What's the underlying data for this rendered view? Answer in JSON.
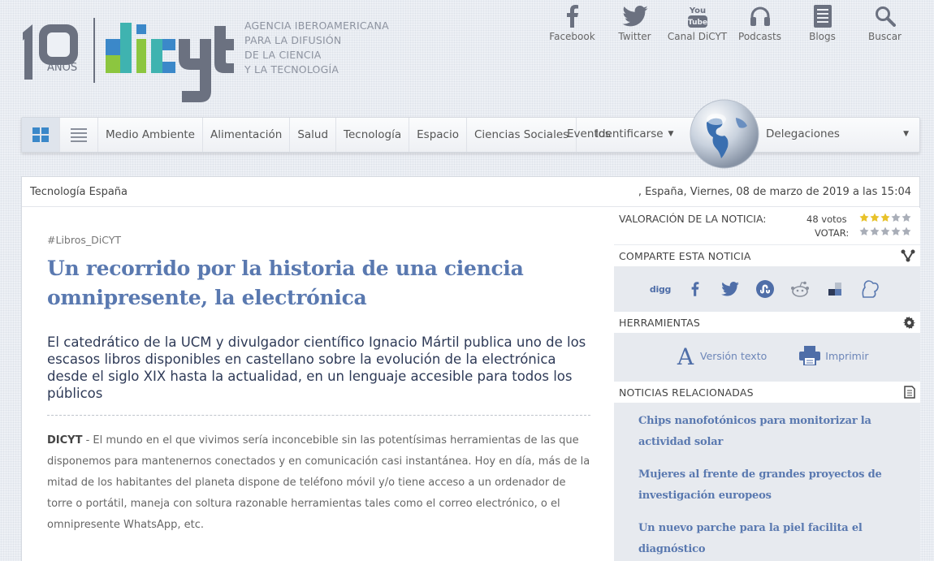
{
  "brand": {
    "anniversary_number": "10",
    "anniversary_label": "AÑOS",
    "name": "dicyt",
    "tagline_lines": [
      "AGENCIA IBEROAMERICANA",
      "PARA LA DIFUSIÓN",
      "DE LA CIENCIA",
      "Y LA TECNOLOGÍA"
    ],
    "colors": {
      "blue": "#3b88c9",
      "teal": "#3fb3b0",
      "green": "#8cc63f",
      "gray": "#6b7180"
    }
  },
  "social": [
    {
      "label": "Facebook",
      "icon": "facebook-icon"
    },
    {
      "label": "Twitter",
      "icon": "twitter-icon"
    },
    {
      "label": "Canal DiCYT",
      "icon": "youtube-icon"
    },
    {
      "label": "Podcasts",
      "icon": "headphones-icon"
    },
    {
      "label": "Blogs",
      "icon": "blog-icon"
    },
    {
      "label": "Buscar",
      "icon": "search-icon"
    }
  ],
  "nav": {
    "items": [
      "Medio Ambiente",
      "Alimentación",
      "Salud",
      "Tecnología",
      "Espacio",
      "Ciencias Sociales"
    ],
    "eventos": "Eventos",
    "login": "Identificarse",
    "delegaciones": "Delegaciones"
  },
  "crumb": {
    "section": "Tecnología España",
    "dateline": ", España, Viernes, 08 de marzo de 2019 a las 15:04"
  },
  "article": {
    "tag": "#Libros_DiCYT",
    "title": "Un recorrido por la historia de una ciencia omnipresente, la electrónica",
    "subtitle": "El catedrático de la UCM y divulgador científico Ignacio Mártil publica uno de los escasos libros disponibles en castellano sobre la evolución de la electrónica desde el siglo XIX hasta la actualidad, en un lenguaje accesible para todos los públicos",
    "lead_source": "DICYT",
    "lead_text": " - El mundo en el que vivimos sería inconcebible sin las potentísimas herramientas de las que disponemos para mantenernos conectados y en comunicación casi instantánea. Hoy en día, más de la mitad de los habitantes del planeta dispone de teléfono móvil y/o tiene acceso a un ordenador de torre o portátil, maneja con soltura razonable herramientas tales como el correo electrónico, o el omnipresente WhatsApp, etc."
  },
  "sidebar": {
    "rating_label": "VALORACIÓN DE LA NOTICIA:",
    "votes": "48 votos",
    "vote_label": "VOTAR:",
    "rating_stars": 3,
    "share_label": "COMPARTE ESTA NOTICIA",
    "share_icons": [
      "digg-icon",
      "facebook-icon",
      "twitter-icon",
      "stumbleupon-icon",
      "reddit-icon",
      "delicious-icon",
      "meneame-icon"
    ],
    "digg_text": "digg",
    "tools_label": "HERRAMIENTAS",
    "tool_text": "Versión texto",
    "tool_print": "Imprimir",
    "related_label": "NOTICIAS RELACIONADAS",
    "related": [
      "Chips nanofotónicos para monitorizar la actividad solar",
      "Mujeres al frente de grandes proyectos de investigación europeos",
      "Un nuevo parche para la piel facilita el diagnóstico"
    ]
  }
}
